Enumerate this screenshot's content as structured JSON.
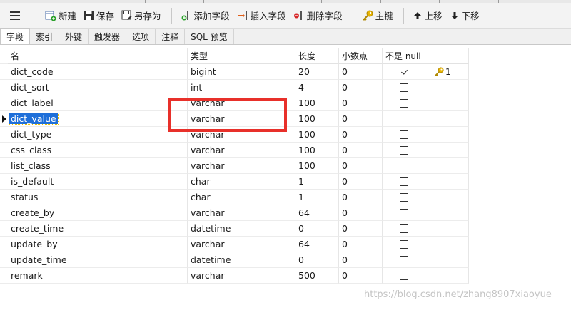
{
  "toolbar": {
    "new_label": "新建",
    "save_label": "保存",
    "save_as_label": "另存为",
    "add_field_label": "添加字段",
    "insert_field_label": "插入字段",
    "delete_field_label": "删除字段",
    "primary_key_label": "主键",
    "move_up_label": "上移",
    "move_down_label": "下移"
  },
  "tabs": [
    {
      "label": "字段",
      "active": true
    },
    {
      "label": "索引"
    },
    {
      "label": "外键"
    },
    {
      "label": "触发器"
    },
    {
      "label": "选项"
    },
    {
      "label": "注释"
    },
    {
      "label": "SQL 预览"
    }
  ],
  "grid": {
    "headers": [
      "名",
      "类型",
      "长度",
      "小数点",
      "不是 null",
      ""
    ],
    "rows": [
      {
        "name": "dict_code",
        "type": "bigint",
        "length": "20",
        "decimals": "0",
        "not_null": true,
        "key": "1"
      },
      {
        "name": "dict_sort",
        "type": "int",
        "length": "4",
        "decimals": "0",
        "not_null": false,
        "key": ""
      },
      {
        "name": "dict_label",
        "type": "varchar",
        "length": "100",
        "decimals": "0",
        "not_null": false,
        "key": ""
      },
      {
        "name": "dict_value",
        "type": "varchar",
        "length": "100",
        "decimals": "0",
        "not_null": false,
        "key": "",
        "selected": true
      },
      {
        "name": "dict_type",
        "type": "varchar",
        "length": "100",
        "decimals": "0",
        "not_null": false,
        "key": ""
      },
      {
        "name": "css_class",
        "type": "varchar",
        "length": "100",
        "decimals": "0",
        "not_null": false,
        "key": ""
      },
      {
        "name": "list_class",
        "type": "varchar",
        "length": "100",
        "decimals": "0",
        "not_null": false,
        "key": ""
      },
      {
        "name": "is_default",
        "type": "char",
        "length": "1",
        "decimals": "0",
        "not_null": false,
        "key": ""
      },
      {
        "name": "status",
        "type": "char",
        "length": "1",
        "decimals": "0",
        "not_null": false,
        "key": ""
      },
      {
        "name": "create_by",
        "type": "varchar",
        "length": "64",
        "decimals": "0",
        "not_null": false,
        "key": ""
      },
      {
        "name": "create_time",
        "type": "datetime",
        "length": "0",
        "decimals": "0",
        "not_null": false,
        "key": ""
      },
      {
        "name": "update_by",
        "type": "varchar",
        "length": "64",
        "decimals": "0",
        "not_null": false,
        "key": ""
      },
      {
        "name": "update_time",
        "type": "datetime",
        "length": "0",
        "decimals": "0",
        "not_null": false,
        "key": ""
      },
      {
        "name": "remark",
        "type": "varchar",
        "length": "500",
        "decimals": "0",
        "not_null": false,
        "key": ""
      }
    ]
  },
  "watermark": "https://blog.csdn.net/zhang8907xiaoyue",
  "colors": {
    "selection": "#1e6fd9",
    "annotation": "#e8302a",
    "key_icon": "#e8b400"
  }
}
